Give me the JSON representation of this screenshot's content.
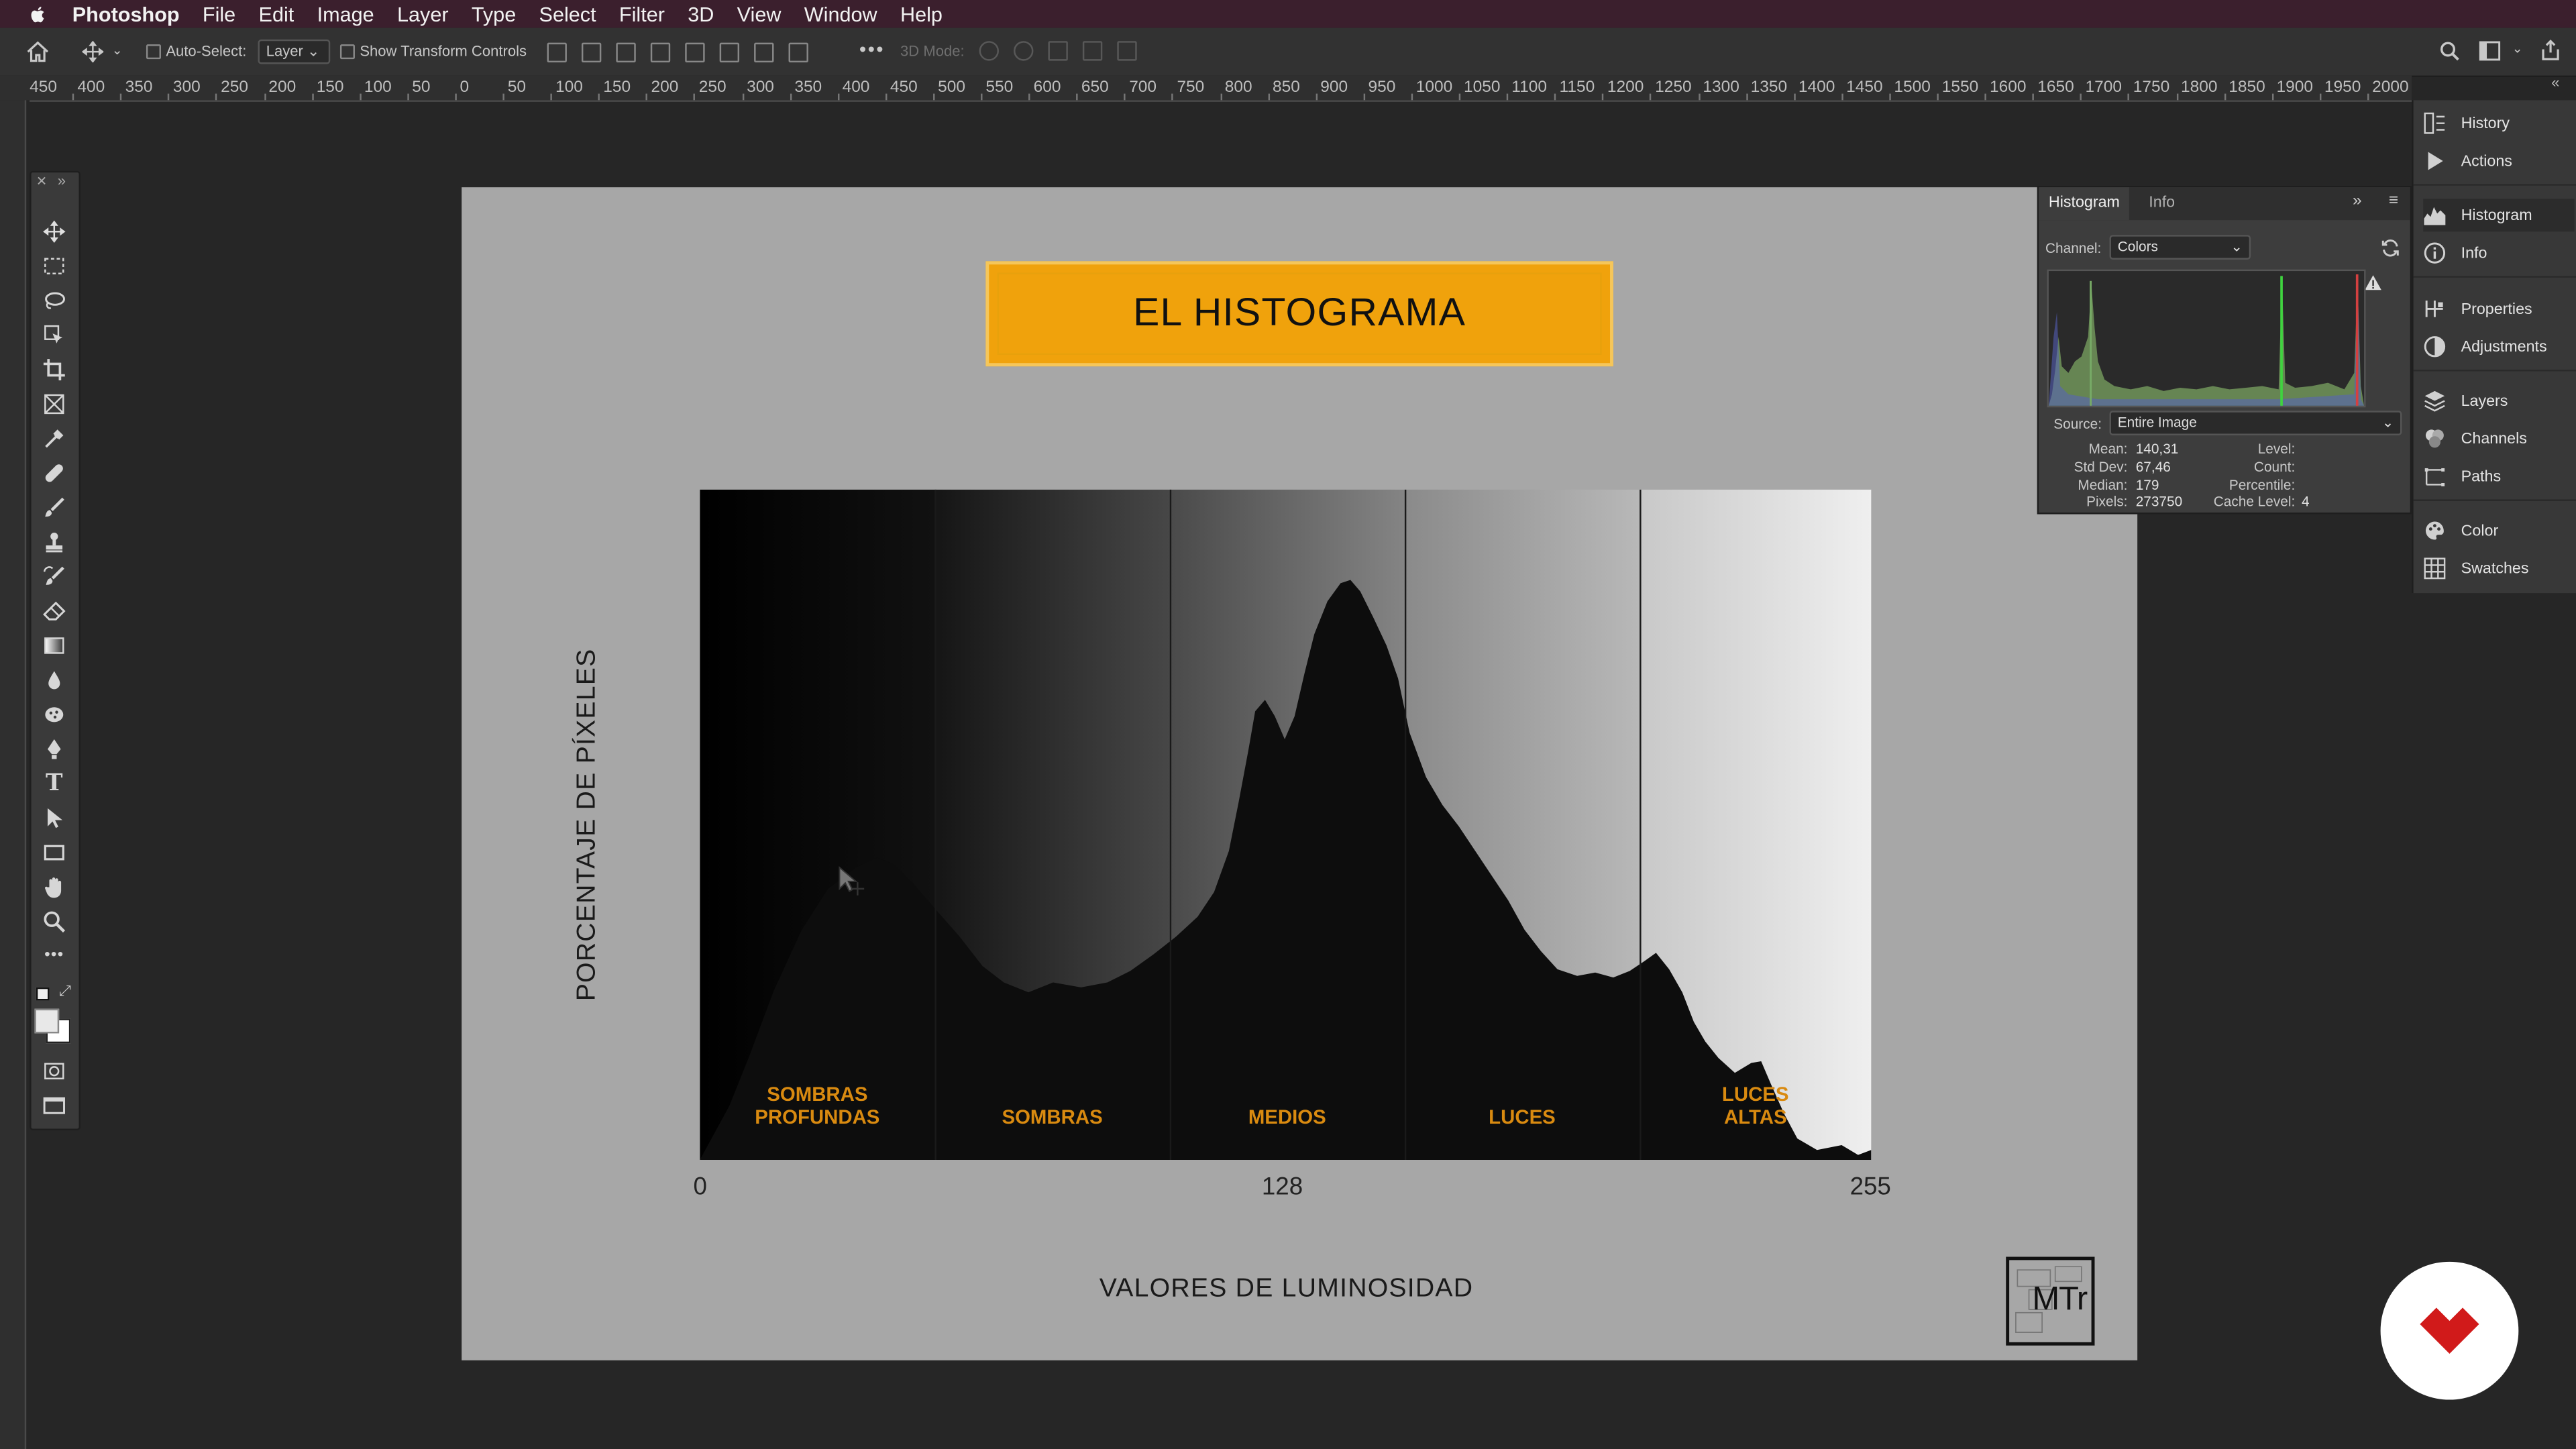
{
  "menubar": {
    "app_name": "Photoshop",
    "items": [
      "File",
      "Edit",
      "Image",
      "Layer",
      "Type",
      "Select",
      "Filter",
      "3D",
      "View",
      "Window",
      "Help"
    ]
  },
  "options": {
    "auto_select_label": "Auto-Select:",
    "auto_select_value": "Layer",
    "transform_label": "Show Transform Controls",
    "mode3d_label": "3D Mode:"
  },
  "ruler": {
    "ticks": [
      "450",
      "400",
      "350",
      "300",
      "250",
      "200",
      "150",
      "100",
      "50",
      "0",
      "50",
      "100",
      "150",
      "200",
      "250",
      "300",
      "350",
      "400",
      "450",
      "500",
      "550",
      "600",
      "650",
      "700",
      "750",
      "800",
      "850",
      "900",
      "950",
      "1000",
      "1050",
      "1100",
      "1150",
      "1200",
      "1250",
      "1300",
      "1350",
      "1400",
      "1450",
      "1500",
      "1550",
      "1600",
      "1650",
      "1700",
      "1750",
      "1800",
      "1850",
      "1900",
      "1950",
      "2000"
    ]
  },
  "slide": {
    "title": "EL HISTOGRAMA",
    "y_axis_label": "PORCENTAJE DE PÍXELES",
    "x_axis_label": "VALORES DE LUMINOSIDAD",
    "x_ticks": [
      "0",
      "128",
      "255"
    ],
    "zones": [
      {
        "line1": "SOMBRAS",
        "line2": "PROFUNDAS"
      },
      {
        "line1": "SOMBRAS",
        "line2": ""
      },
      {
        "line1": "MEDIOS",
        "line2": ""
      },
      {
        "line1": "LUCES",
        "line2": ""
      },
      {
        "line1": "LUCES",
        "line2": "ALTAS"
      }
    ],
    "logo_text": "MTr",
    "colors": {
      "title_fill": "#f0a20c",
      "zone_label": "#d98a10",
      "background": "#a7a7a7"
    }
  },
  "histogram_panel": {
    "tabs": [
      "Histogram",
      "Info"
    ],
    "channel_label": "Channel:",
    "channel_value": "Colors",
    "source_label": "Source:",
    "source_value": "Entire Image",
    "stats_left": [
      {
        "label": "Mean:",
        "value": "140,31"
      },
      {
        "label": "Std Dev:",
        "value": "67,46"
      },
      {
        "label": "Median:",
        "value": "179"
      },
      {
        "label": "Pixels:",
        "value": "273750"
      }
    ],
    "stats_right": [
      {
        "label": "Level:",
        "value": ""
      },
      {
        "label": "Count:",
        "value": ""
      },
      {
        "label": "Percentile:",
        "value": ""
      },
      {
        "label": "Cache Level:",
        "value": "4"
      }
    ]
  },
  "dock": {
    "items": [
      "History",
      "Actions",
      "Histogram",
      "Info",
      "Properties",
      "Adjustments",
      "Layers",
      "Channels",
      "Paths",
      "Color",
      "Swatches"
    ],
    "active": "Histogram"
  }
}
